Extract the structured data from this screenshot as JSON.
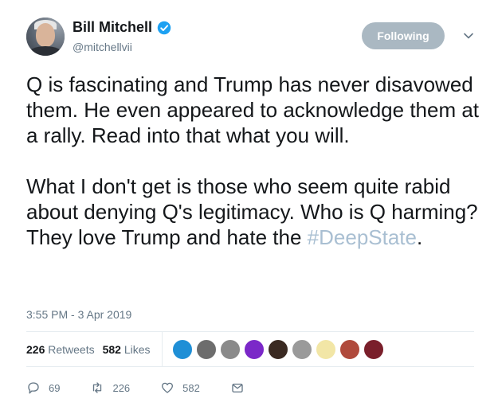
{
  "author": {
    "display_name": "Bill Mitchell",
    "handle": "@mitchellvii",
    "verified_icon": "verified-badge-icon"
  },
  "follow_button": {
    "label": "Following"
  },
  "tweet": {
    "para1": "Q is fascinating and Trump has never disavowed them. He even appeared to acknowledge them at a rally.  Read into that what you will.",
    "para2_text": "What I don't get is those who seem quite rabid about denying Q's legitimacy.  Who is Q harming?  They love Trump and hate the ",
    "hashtag": "#DeepState",
    "para2_end": "."
  },
  "timestamp": "3:55 PM - 3 Apr 2019",
  "stats": {
    "retweets_count": "226",
    "retweets_label": "Retweets",
    "likes_count": "582",
    "likes_label": "Likes"
  },
  "liker_avatars": [
    {
      "color": "#1f8fd6"
    },
    {
      "color": "#6d6d6d"
    },
    {
      "color": "#8a8a8a"
    },
    {
      "color": "#7b28c8"
    },
    {
      "color": "#3a2a22"
    },
    {
      "color": "#9a9a9a"
    },
    {
      "color": "#f2e6a6"
    },
    {
      "color": "#b04a3c"
    },
    {
      "color": "#7a1f2b"
    }
  ],
  "actions": {
    "reply_count": "69",
    "retweet_count": "226",
    "like_count": "582"
  },
  "colors": {
    "text": "#14171a",
    "muted": "#657786",
    "follow_button_bg": "#aab8c2",
    "verified_blue": "#1da1f2",
    "hashtag": "#a9bfd2"
  }
}
